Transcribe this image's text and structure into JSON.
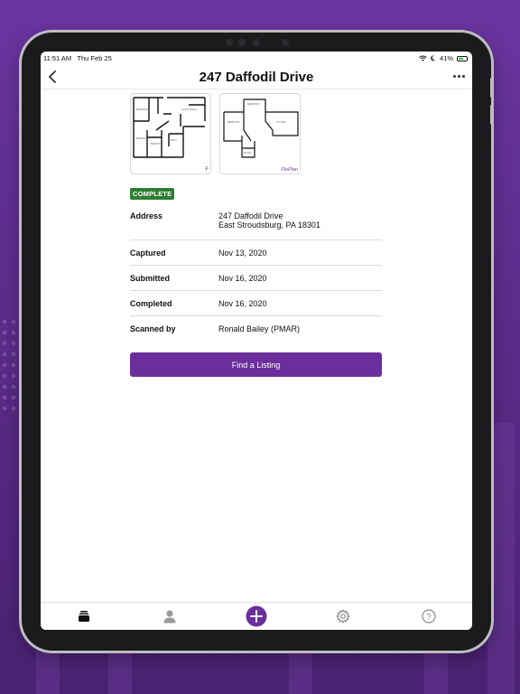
{
  "status_bar": {
    "time": "11:51 AM",
    "date": "Thu Feb 25",
    "battery": "41%"
  },
  "nav": {
    "title": "247 Daffodil Drive",
    "back_icon": "chevron-left-icon",
    "more_icon": "ellipsis-icon"
  },
  "thumbnails": [
    {
      "name": "floor-plan-1",
      "tag": "F"
    },
    {
      "name": "floor-plan-2",
      "tag": "FloPlan"
    }
  ],
  "status_badge": "COMPLETE",
  "details": {
    "address_label": "Address",
    "address_line1": "247 Daffodil Drive",
    "address_line2": "East Stroudsburg, PA 18301",
    "captured_label": "Captured",
    "captured_value": "Nov 13, 2020",
    "submitted_label": "Submitted",
    "submitted_value": "Nov 16, 2020",
    "completed_label": "Completed",
    "completed_value": "Nov 16, 2020",
    "scanned_label": "Scanned by",
    "scanned_value": "Ronald Bailey (PMAR)"
  },
  "cta_label": "Find a Listing",
  "tabs": [
    {
      "icon": "stack-icon",
      "active": true
    },
    {
      "icon": "person-icon",
      "active": false
    },
    {
      "icon": "plus-circle-icon",
      "active": false
    },
    {
      "icon": "gear-icon",
      "active": false
    },
    {
      "icon": "help-icon",
      "active": false
    }
  ],
  "colors": {
    "accent": "#6a2f9c",
    "badge": "#2e7d32",
    "background": "#5a2d86"
  }
}
